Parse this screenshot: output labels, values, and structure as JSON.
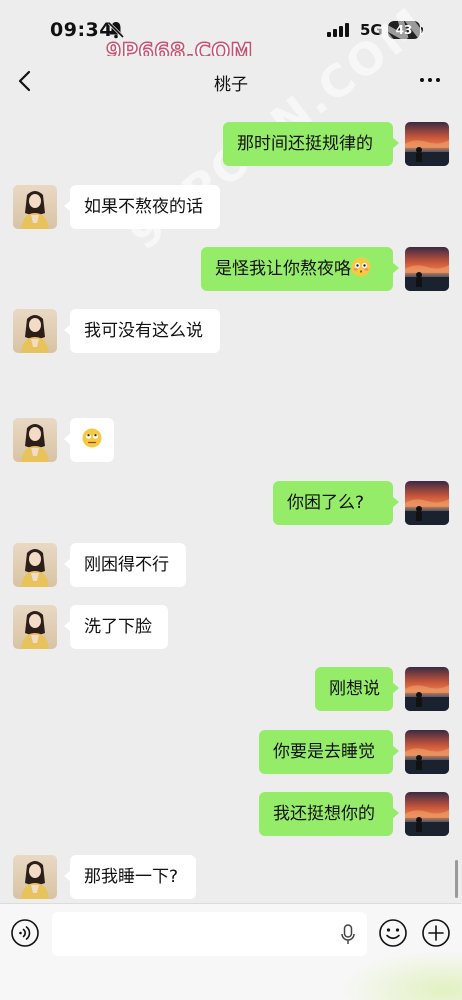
{
  "status_bar": {
    "time": "09:34",
    "network": "5G",
    "battery": "43",
    "watermark": "9P668.COM"
  },
  "nav": {
    "title": "桃子"
  },
  "messages": [
    {
      "sender": "me",
      "text": "那时间还挺规律的"
    },
    {
      "sender": "them",
      "text": "如果不熬夜的话"
    },
    {
      "sender": "me",
      "text": "是怪我让你熬夜咯",
      "emoji": "flushed-face"
    },
    {
      "sender": "them",
      "text": "我可没有这么说"
    },
    {
      "sender": "them",
      "text": "",
      "emoji": "rolling-eyes-face"
    },
    {
      "sender": "me",
      "text": "你困了么?"
    },
    {
      "sender": "them",
      "text": "刚困得不行"
    },
    {
      "sender": "them",
      "text": "洗了下脸"
    },
    {
      "sender": "me",
      "text": "刚想说"
    },
    {
      "sender": "me",
      "text": "你要是去睡觉"
    },
    {
      "sender": "me",
      "text": "我还挺想你的"
    },
    {
      "sender": "them",
      "text": "那我睡一下?"
    }
  ],
  "watermark_diagonal": "91PORN.COM",
  "input_bar": {
    "value": "",
    "placeholder": ""
  },
  "colors": {
    "background": "#ededed",
    "my_bubble": "#95ec69",
    "their_bubble": "#ffffff"
  }
}
